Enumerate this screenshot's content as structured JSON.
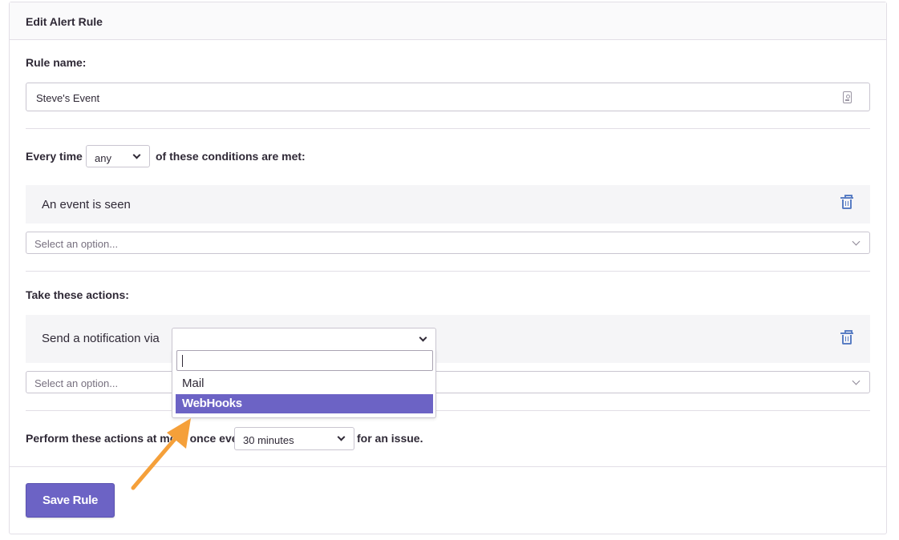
{
  "panel": {
    "title": "Edit Alert Rule"
  },
  "rule_name": {
    "label": "Rule name:",
    "value": "Steve's Event",
    "field_icon": "contact-card-icon"
  },
  "conditions": {
    "prefix": "Every time",
    "match_value": "any",
    "suffix": "of these conditions are met:",
    "items": [
      {
        "text": "An event is seen"
      }
    ],
    "add_placeholder": "Select an option..."
  },
  "actions": {
    "label": "Take these actions:",
    "items": [
      {
        "text": "Send a notification via"
      }
    ],
    "dropdown": {
      "search_value": "",
      "options": [
        {
          "label": "Mail",
          "highlighted": false
        },
        {
          "label": "WebHooks",
          "highlighted": true
        }
      ]
    },
    "add_placeholder": "Select an option..."
  },
  "frequency": {
    "prefix": "Perform these actions at most once every",
    "value": "30 minutes",
    "suffix": "for an issue."
  },
  "save_button": {
    "label": "Save Rule"
  },
  "colors": {
    "accent": "#6c63c5",
    "arrow": "#f5a03a",
    "trash": "#5a7ec4"
  }
}
